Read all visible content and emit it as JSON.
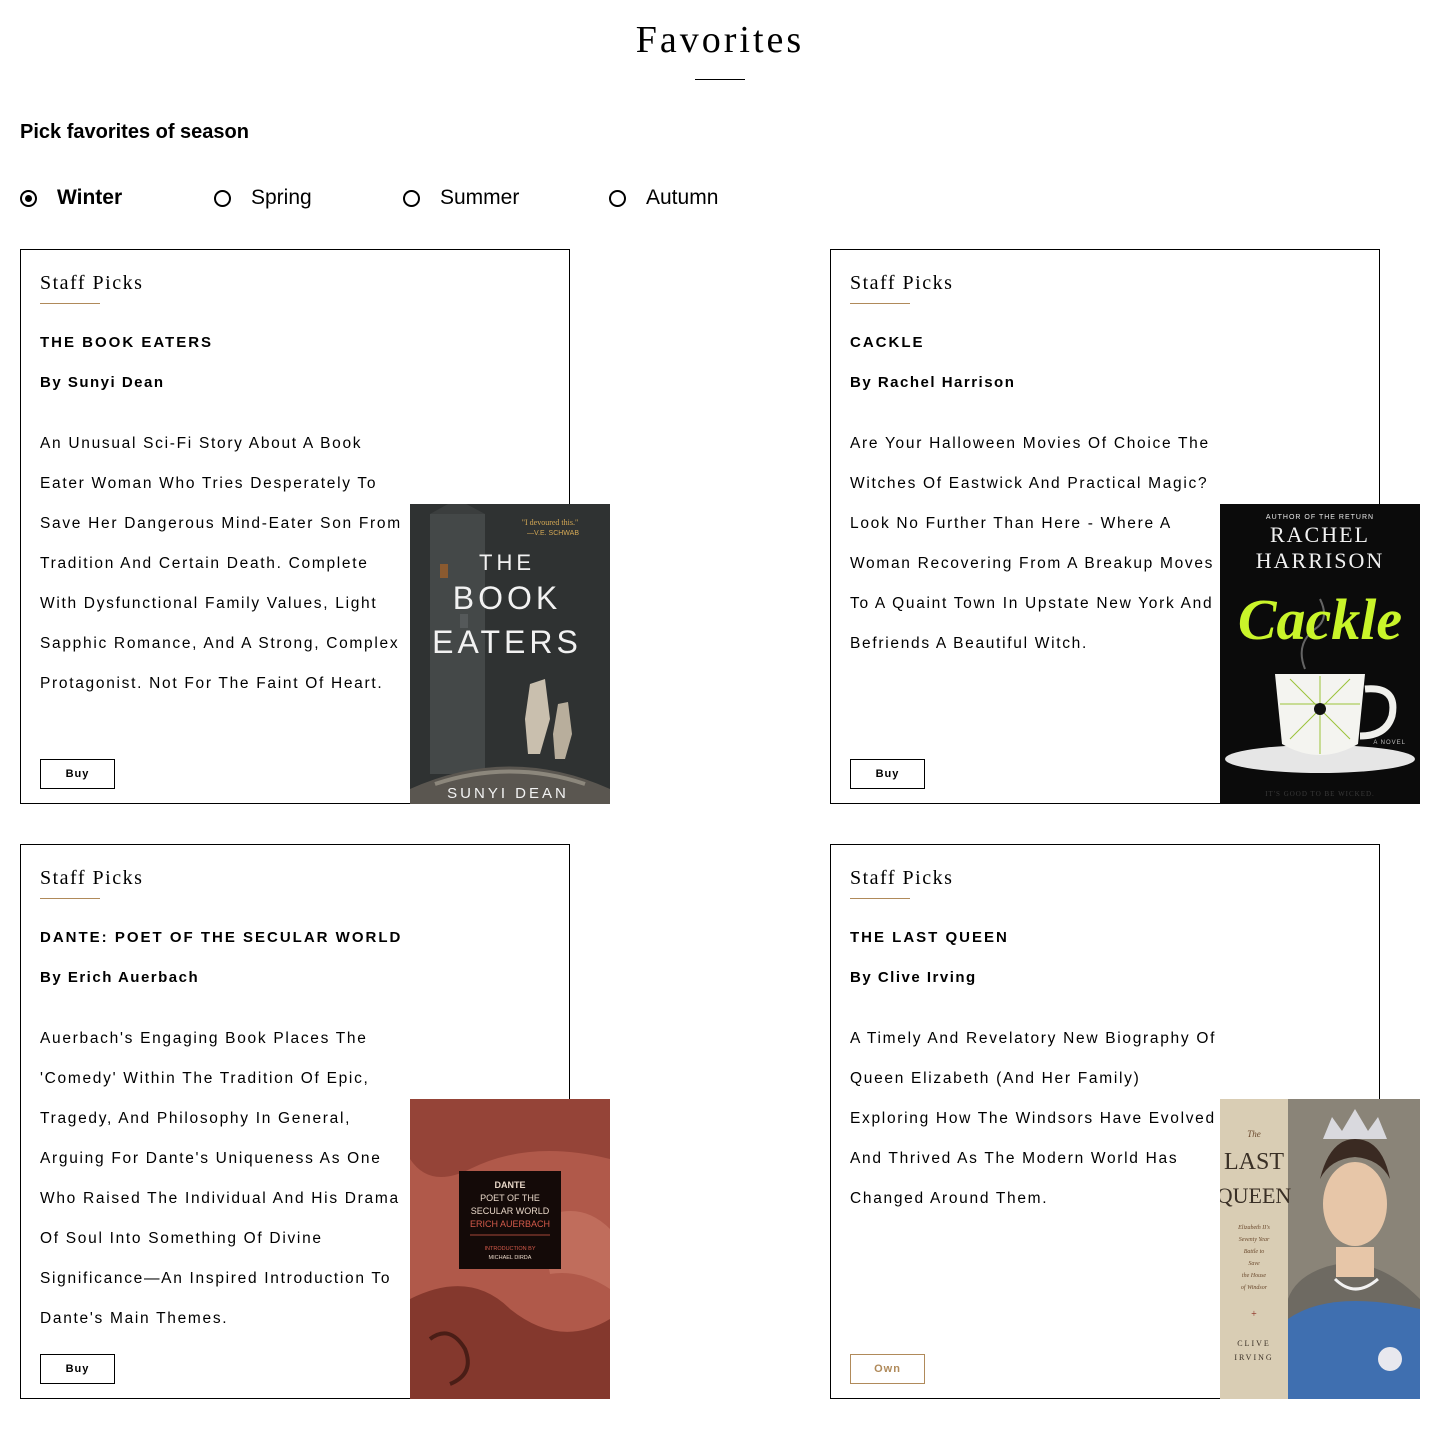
{
  "page": {
    "title": "Favorites"
  },
  "season_picker": {
    "heading": "Pick favorites of season",
    "options": [
      {
        "label": "Winter",
        "selected": true
      },
      {
        "label": "Spring",
        "selected": false
      },
      {
        "label": "Summer",
        "selected": false
      },
      {
        "label": "Autumn",
        "selected": false
      }
    ]
  },
  "colors": {
    "accent_rule": "#b08a5a",
    "own_button": "#b08a5a"
  },
  "cards": [
    {
      "tag": "Staff Picks",
      "title": "THE BOOK EATERS",
      "author": "By Sunyi Dean",
      "description": "An Unusual Sci-Fi Story About A Book Eater Woman Who Tries Desperately To Save Her Dangerous Mind-Eater Son From Tradition And Certain Death. Complete With Dysfunctional Family Values, Light Sapphic Romance, And A Strong, Complex Protagonist. Not For The Faint Of Heart.",
      "button": "Buy",
      "cover": {
        "quote": "\"I devoured this.\"",
        "quote_by": "—V.E. SCHWAB",
        "title_line1": "THE",
        "title_line2": "BOOK",
        "title_line3": "EATERS",
        "author": "SUNYI DEAN"
      }
    },
    {
      "tag": "Staff Picks",
      "title": "CACKLE",
      "author": "By Rachel Harrison",
      "description": "Are Your Halloween Movies Of Choice The Witches Of Eastwick And Practical Magic? Look No Further Than Here - Where A Woman Recovering From A Breakup Moves To A Quaint Town In Upstate New York And Befriends A Beautiful Witch.",
      "button": "Buy",
      "cover": {
        "kicker": "AUTHOR OF THE RETURN",
        "author_line1": "RACHEL",
        "author_line2": "HARRISON",
        "title": "Cackle",
        "side": "A NOVEL",
        "tagline": "IT'S GOOD TO BE WICKED."
      }
    },
    {
      "tag": "Staff Picks",
      "title": "DANTE: POET OF THE SECULAR WORLD",
      "author": "By Erich Auerbach",
      "description": "Auerbach's Engaging Book Places The 'Comedy' Within The Tradition Of Epic, Tragedy, And Philosophy In General, Arguing For Dante's Uniqueness As One Who Raised The Individual And His Drama Of Soul Into Something Of Divine Significance—An Inspired Introduction To Dante's Main Themes.",
      "button": "Buy",
      "cover": {
        "line1": "DANTE",
        "line2": "POET OF THE",
        "line3": "SECULAR WORLD",
        "line4": "ERICH AUERBACH",
        "intro1": "INTRODUCTION BY",
        "intro2": "MICHAEL DIRDA"
      }
    },
    {
      "tag": "Staff Picks",
      "title": "THE LAST QUEEN",
      "author": "By Clive Irving",
      "description": "A Timely And Revelatory New Biography Of Queen Elizabeth (And Her Family) Exploring How The Windsors Have Evolved And Thrived As The Modern World Has Changed Around Them.",
      "button": "Own",
      "cover": {
        "the": "The",
        "last": "LAST",
        "queen": "QUEEN",
        "sub1": "Elizabeth II's",
        "sub2": "Seventy Year",
        "sub3": "Battle to",
        "sub4": "Save",
        "sub5": "the House",
        "sub6": "of Windsor",
        "author1": "CLIVE",
        "author2": "IRVING"
      }
    }
  ]
}
